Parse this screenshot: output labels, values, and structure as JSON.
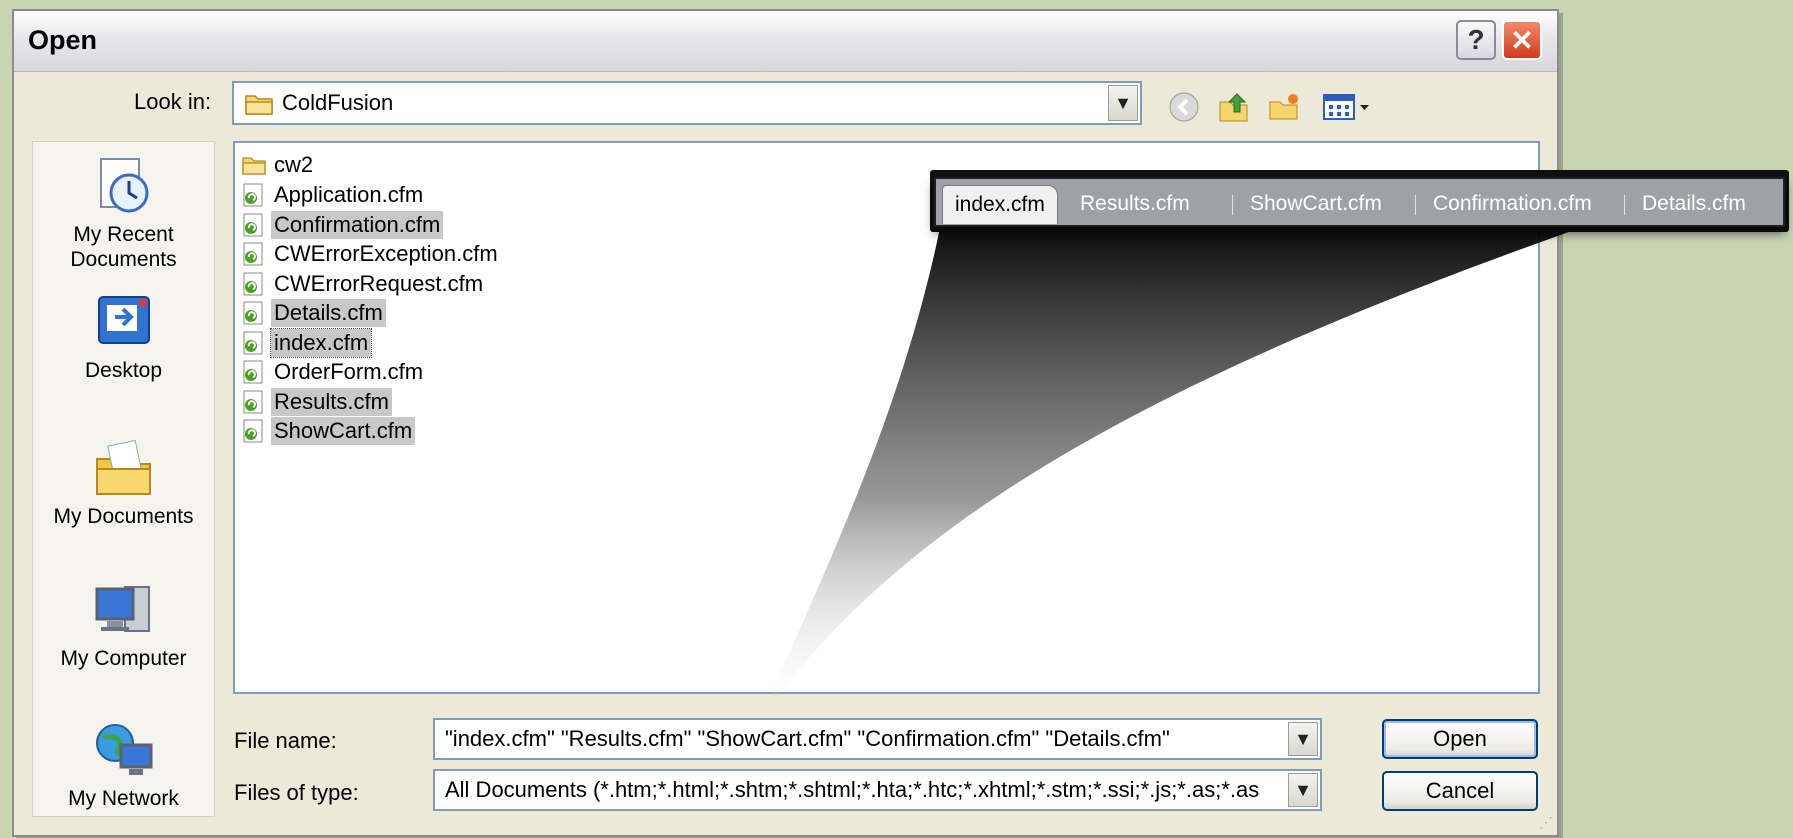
{
  "window": {
    "title": "Open",
    "help_label": "?",
    "close_label": "✕"
  },
  "look_in": {
    "label": "Look in:",
    "value": "ColdFusion"
  },
  "places": [
    {
      "label": "My Recent\nDocuments",
      "icon": "recent-documents-icon"
    },
    {
      "label": "Desktop",
      "icon": "desktop-icon"
    },
    {
      "label": "My Documents",
      "icon": "my-documents-icon"
    },
    {
      "label": "My Computer",
      "icon": "my-computer-icon"
    },
    {
      "label": "My Network",
      "icon": "network-icon"
    }
  ],
  "files": [
    {
      "name": "cw2",
      "type": "folder",
      "selected": false
    },
    {
      "name": "Application.cfm",
      "type": "cfm",
      "selected": false
    },
    {
      "name": "Confirmation.cfm",
      "type": "cfm",
      "selected": true
    },
    {
      "name": "CWErrorException.cfm",
      "type": "cfm",
      "selected": false
    },
    {
      "name": "CWErrorRequest.cfm",
      "type": "cfm",
      "selected": false
    },
    {
      "name": "Details.cfm",
      "type": "cfm",
      "selected": true
    },
    {
      "name": "index.cfm",
      "type": "cfm",
      "selected": true,
      "focused": true
    },
    {
      "name": "OrderForm.cfm",
      "type": "cfm",
      "selected": false
    },
    {
      "name": "Results.cfm",
      "type": "cfm",
      "selected": true
    },
    {
      "name": "ShowCart.cfm",
      "type": "cfm",
      "selected": true
    }
  ],
  "file_name": {
    "label": "File name:",
    "value": "\"index.cfm\" \"Results.cfm\" \"ShowCart.cfm\" \"Confirmation.cfm\" \"Details.cfm\""
  },
  "file_type": {
    "label": "Files of type:",
    "value": "All Documents (*.htm;*.html;*.shtm;*.shtml;*.hta;*.htc;*.xhtml;*.stm;*.ssi;*.js;*.as;*.as"
  },
  "buttons": {
    "open": "Open",
    "cancel": "Cancel"
  },
  "tabs": [
    "index.cfm",
    "Results.cfm",
    "ShowCart.cfm",
    "Confirmation.cfm",
    "Details.cfm"
  ],
  "colors": {
    "background": "#c9d4b3",
    "dialog": "#ece9d8",
    "selection": "#c8c8c8",
    "tabstrip": "#9ea2a8"
  }
}
